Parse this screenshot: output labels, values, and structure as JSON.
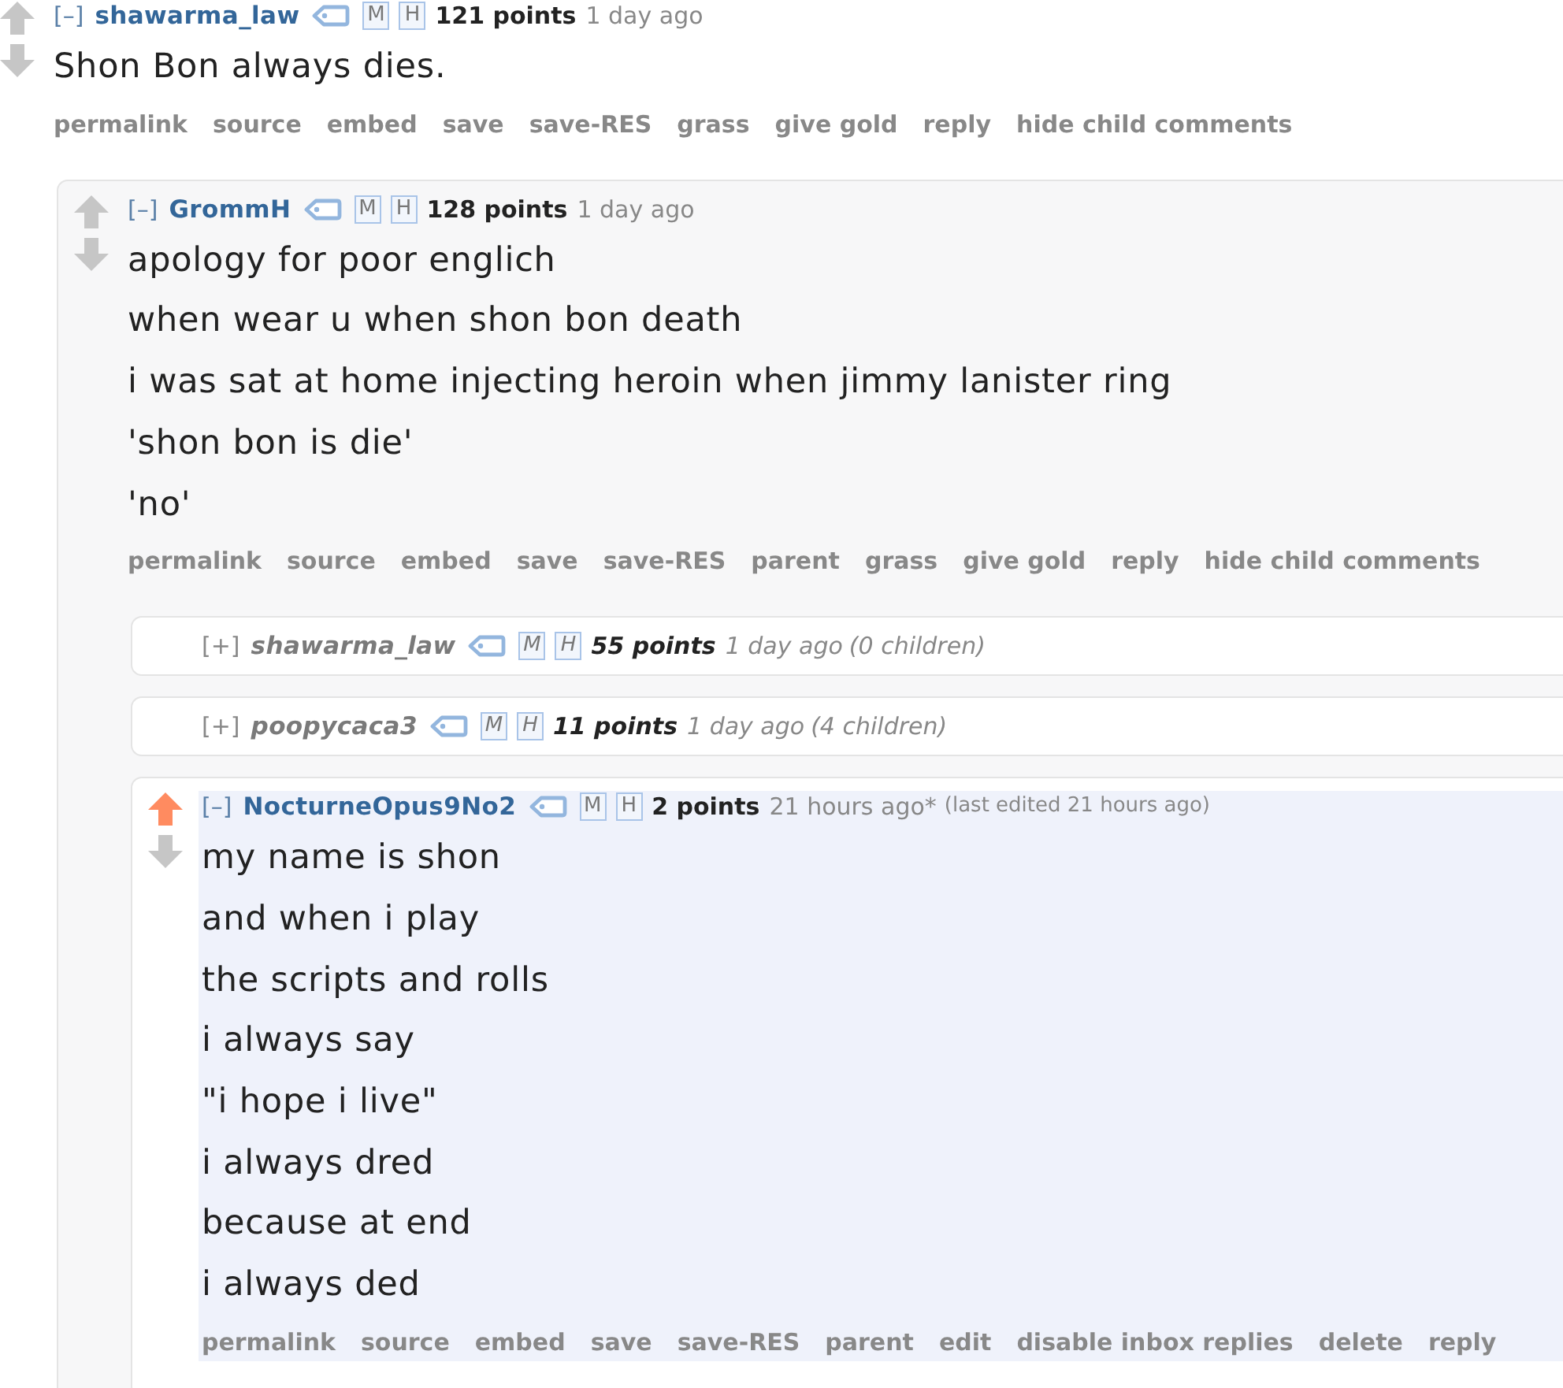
{
  "comments": [
    {
      "collapsed": false,
      "upvoted": false,
      "downvoted": false,
      "highlighted": false,
      "toggle": "[–]",
      "author": "shawarma_law",
      "tag_buttons": [
        "M",
        "H"
      ],
      "points": "121 points",
      "time": "1 day ago",
      "body": [
        "Shon Bon always dies."
      ],
      "buttons": [
        "permalink",
        "source",
        "embed",
        "save",
        "save-RES",
        "grass",
        "give gold",
        "reply",
        "hide child comments"
      ],
      "children": [
        {
          "collapsed": false,
          "upvoted": false,
          "downvoted": false,
          "toggle": "[–]",
          "author": "GrommH",
          "tag_buttons": [
            "M",
            "H"
          ],
          "points": "128 points",
          "time": "1 day ago",
          "body": [
            "apology for poor englich",
            "when wear u when shon bon death",
            "i was sat at home injecting heroin when jimmy lanister ring",
            "'shon bon is die'",
            "'no'"
          ],
          "buttons": [
            "permalink",
            "source",
            "embed",
            "save",
            "save-RES",
            "parent",
            "grass",
            "give gold",
            "reply",
            "hide child comments"
          ],
          "children": [
            {
              "collapsed": true,
              "toggle": "[+]",
              "author": "shawarma_law",
              "tag_buttons": [
                "M",
                "H"
              ],
              "points": "55 points",
              "time": "1 day ago",
              "child_count": "(0 children)"
            },
            {
              "collapsed": true,
              "toggle": "[+]",
              "author": "poopycaca3",
              "tag_buttons": [
                "M",
                "H"
              ],
              "points": "11 points",
              "time": "1 day ago",
              "child_count": "(4 children)"
            },
            {
              "collapsed": false,
              "upvoted": true,
              "downvoted": false,
              "highlighted": true,
              "toggle": "[–]",
              "author": "NocturneOpus9No2",
              "tag_buttons": [
                "M",
                "H"
              ],
              "points": "2 points",
              "time": "21 hours ago*",
              "edited": "(last edited 21 hours ago)",
              "body": [
                "my name is shon",
                "and when i play",
                "the scripts and rolls",
                "i always say",
                "\"i hope i live\"",
                "i always dred",
                "because at end",
                "i always ded"
              ],
              "buttons": [
                "permalink",
                "source",
                "embed",
                "save",
                "save-RES",
                "parent",
                "edit",
                "disable inbox replies",
                "delete",
                "reply"
              ]
            }
          ]
        }
      ]
    }
  ]
}
